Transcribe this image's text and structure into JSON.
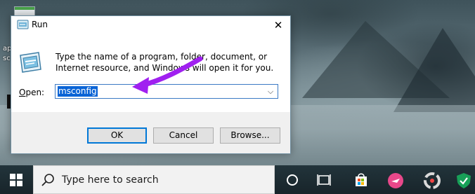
{
  "desktop": {
    "icon_label_1": "ap",
    "icon_label_2": "sc"
  },
  "dialog": {
    "title": "Run",
    "close_glyph": "✕",
    "description": "Type the name of a program, folder, document, or Internet resource, and Windows will open it for you.",
    "open_label_prefix": "O",
    "open_label_rest": "pen:",
    "open_value": "msconfig",
    "dropdown_glyph": "⌵",
    "buttons": {
      "ok": "OK",
      "cancel": "Cancel",
      "browse": "Browse..."
    }
  },
  "annotation": {
    "arrow_color": "#a020f0"
  },
  "taskbar": {
    "search_placeholder": "Type here to search",
    "items": [
      "cortana-icon",
      "task-view-icon",
      "store-icon",
      "app-icon-pink",
      "app-icon-gray",
      "shield-icon"
    ]
  }
}
